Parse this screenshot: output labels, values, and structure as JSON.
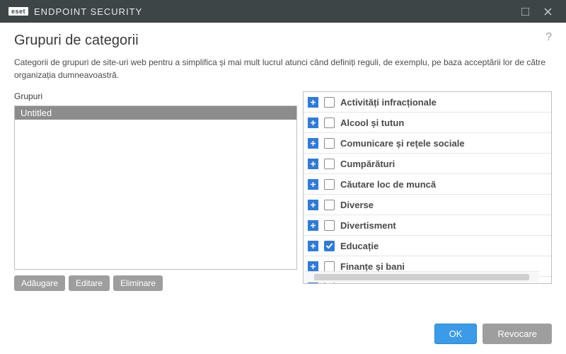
{
  "titlebar": {
    "brand_box": "eset",
    "brand_text": "ENDPOINT SECURITY"
  },
  "heading": "Grupuri de categorii",
  "description": "Categorii de grupuri de site-uri web pentru a simplifica și mai mult lucrul atunci când definiți reguli, de exemplu, pe baza acceptării lor de către organizația dumneavoastră.",
  "groups": {
    "label": "Grupuri",
    "items": [
      {
        "name": "Untitled",
        "selected": true
      }
    ],
    "buttons": {
      "add": "Adăugare",
      "edit": "Editare",
      "remove": "Eliminare"
    }
  },
  "categories": [
    {
      "label": "Activități infracționale",
      "checked": false
    },
    {
      "label": "Alcool și tutun",
      "checked": false
    },
    {
      "label": "Comunicare și rețele sociale",
      "checked": false
    },
    {
      "label": "Cumpărături",
      "checked": false
    },
    {
      "label": "Căutare loc de muncă",
      "checked": false
    },
    {
      "label": "Diverse",
      "checked": false
    },
    {
      "label": "Divertisment",
      "checked": false
    },
    {
      "label": "Educație",
      "checked": true
    },
    {
      "label": "Finanțe și bani",
      "checked": false
    },
    {
      "label": "Fără categorie",
      "checked": false
    }
  ],
  "footer": {
    "ok": "OK",
    "cancel": "Revocare"
  }
}
